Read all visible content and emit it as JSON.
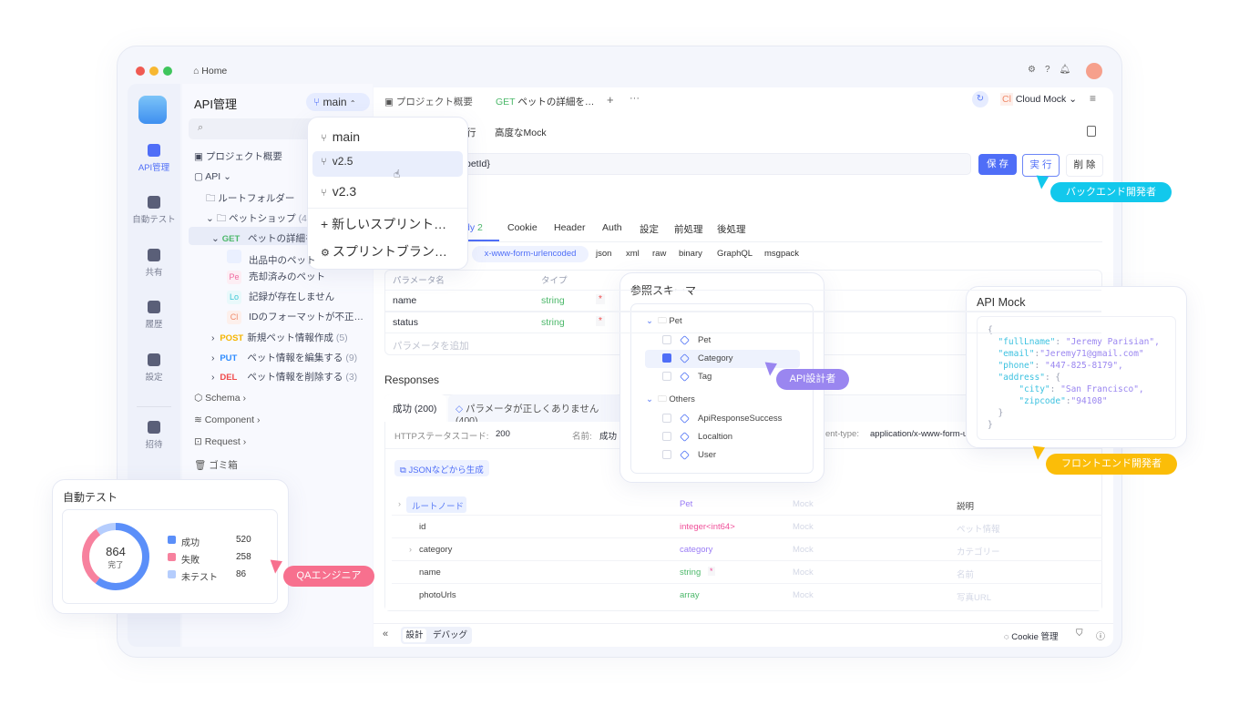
{
  "titlebar": {
    "home": "Home"
  },
  "rail": {
    "items": [
      {
        "label": "API管理",
        "icon": "api-icon"
      },
      {
        "label": "自動テスト",
        "icon": "test-icon"
      },
      {
        "label": "共有",
        "icon": "share-icon"
      },
      {
        "label": "履歴",
        "icon": "history-icon"
      },
      {
        "label": "設定",
        "icon": "settings-icon"
      },
      {
        "label": "招待",
        "icon": "invite-icon"
      }
    ]
  },
  "sidebar": {
    "title": "API管理",
    "branch": "main",
    "overview": "プロジェクト概要",
    "api": "API",
    "root": "ルートフォルダー",
    "petshop": "ペットショップ",
    "petshop_count": "(4)",
    "get": {
      "method": "GET",
      "label": "ペットの詳細を"
    },
    "children": [
      {
        "badge": "",
        "label": "出品中のペット",
        "color": "#5b7cf6",
        "bg": "#eaf0ff"
      },
      {
        "badge": "Pe",
        "label": "売却済みのペット",
        "color": "#f06aa0",
        "bg": "#fdeef4"
      },
      {
        "badge": "Lo",
        "label": "記録が存在しません",
        "color": "#3cc7d6",
        "bg": "#e9f9fb"
      },
      {
        "badge": "Cl",
        "label": "IDのフォーマットが不正…",
        "color": "#f08a6a",
        "bg": "#fdf0ec"
      }
    ],
    "methods": [
      {
        "method": "POST",
        "label": "新規ペット情報作成",
        "count": "(5)",
        "color": "#f5b400"
      },
      {
        "method": "PUT",
        "label": "ペット情報を編集する",
        "count": "(9)",
        "color": "#2f8cff"
      },
      {
        "method": "DEL",
        "label": "ペット情報を削除する",
        "count": "(3)",
        "color": "#f04b4b"
      }
    ],
    "sections": [
      "Schema",
      "Component",
      "Request",
      "ゴミ箱"
    ]
  },
  "branch_menu": {
    "items": [
      "main",
      "v2.5",
      "v2.3"
    ],
    "new_sprint": "新しいスプリント…",
    "sprint_branch": "スプリントブラン…"
  },
  "tabs": {
    "overview": "プロジェクト概要",
    "active_method": "GET",
    "active_label": "ペットの詳細を…",
    "env": "Cloud Mock",
    "env_badge": "Cl"
  },
  "subtabs": [
    "行",
    "高度なMock"
  ],
  "url": {
    "value": "petId}"
  },
  "actions": {
    "save": "保 存",
    "run": "実 行",
    "delete": "削 除"
  },
  "params_tabs": {
    "body": "dy",
    "body_count": "2",
    "others": [
      "Cookie",
      "Header",
      "Auth",
      "設定",
      "前処理",
      "後処理"
    ]
  },
  "body_types": {
    "active": "x-www-form-urlencoded",
    "others": [
      "json",
      "xml",
      "raw",
      "binary",
      "GraphQL",
      "msgpack"
    ]
  },
  "params_table": {
    "headers": [
      "パラメータ名",
      "タイプ"
    ],
    "rows": [
      {
        "name": "name",
        "type": "string"
      },
      {
        "name": "status",
        "type": "string"
      }
    ],
    "add": "パラメータを追加"
  },
  "responses": {
    "title": "Responses",
    "tab_ok": "成功 (200)",
    "tab_err": "パラメータが正しくありません (400)",
    "status_label": "HTTPステータスコード:",
    "status": "200",
    "name_label": "名前:",
    "name": "成功",
    "ct_label": "ent-type:",
    "ct": "application/x-www-form-ur",
    "generate": "JSONなどから生成",
    "tree": [
      {
        "name": "ルートノード",
        "type": "Pet",
        "mock": "Mock",
        "desc": "説明",
        "tc": "#9a7cf5"
      },
      {
        "name": "id",
        "type": "integer<int64>",
        "mock": "Mock",
        "desc": "ペット情報",
        "tc": "#f0509a"
      },
      {
        "name": "category",
        "type": "category",
        "mock": "Mock",
        "desc": "カテゴリー",
        "tc": "#9a7cf5"
      },
      {
        "name": "name",
        "type": "string",
        "mock": "Mock",
        "desc": "名前",
        "tc": "#4cb86a"
      },
      {
        "name": "photoUrls",
        "type": "array",
        "mock": "Mock",
        "desc": "写真URL",
        "tc": "#4cb86a"
      }
    ]
  },
  "bottom": {
    "design": "設計",
    "debug": "デバッグ",
    "cookie": "Cookie 管理"
  },
  "schema": {
    "title": "参照スキーマ",
    "groups": [
      {
        "name": "Pet",
        "items": [
          {
            "label": "Pet",
            "checked": false
          },
          {
            "label": "Category",
            "checked": true
          },
          {
            "label": "Tag",
            "checked": false
          }
        ]
      },
      {
        "name": "Others",
        "items": [
          {
            "label": "ApiResponseSuccess",
            "checked": false
          },
          {
            "label": "Localtion",
            "checked": false
          },
          {
            "label": "User",
            "checked": false
          }
        ]
      }
    ]
  },
  "mock": {
    "title": "API Mock",
    "fullLname": "Jeremy Parisian",
    "email": "Jeremy71@gmail.com",
    "phone": "447-825-8179",
    "city": "San Francisco",
    "zipcode": "94108"
  },
  "autotest": {
    "title": "自動テスト",
    "total": "864",
    "total_label": "完了",
    "legend": [
      {
        "label": "成功",
        "value": 520,
        "color": "#5b8ff9"
      },
      {
        "label": "失敗",
        "value": 258,
        "color": "#f7819e"
      },
      {
        "label": "未テスト",
        "value": 86,
        "color": "#b5cdfd"
      }
    ]
  },
  "roles": {
    "qa": "QAエンジニア",
    "designer": "API設計者",
    "backend": "バックエンド開発者",
    "frontend": "フロントエンド開発者"
  },
  "colors": {
    "accent": "#4f6ef7",
    "qa": "#f7708e",
    "designer": "#9a86f0",
    "backend": "#12c8ec",
    "frontend": "#fbbd08"
  }
}
